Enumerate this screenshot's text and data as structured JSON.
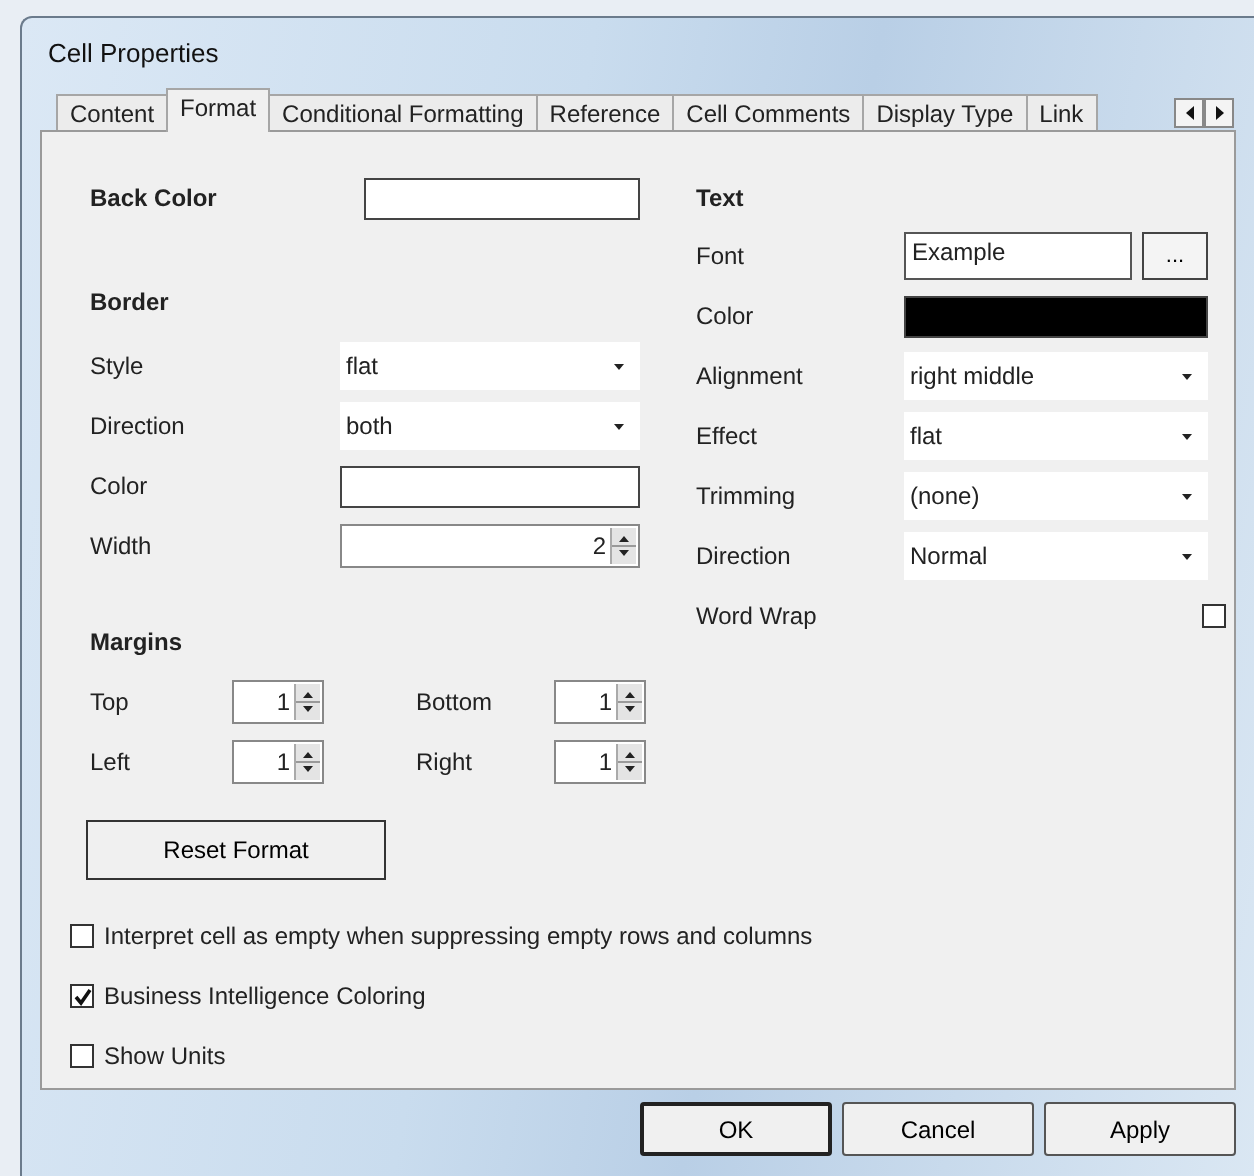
{
  "window": {
    "title": "Cell Properties"
  },
  "tabs": [
    {
      "label": "Content",
      "selected": false
    },
    {
      "label": "Format",
      "selected": true
    },
    {
      "label": "Conditional Formatting",
      "selected": false
    },
    {
      "label": "Reference",
      "selected": false
    },
    {
      "label": "Cell Comments",
      "selected": false
    },
    {
      "label": "Display Type",
      "selected": false
    },
    {
      "label": "Link",
      "selected": false
    }
  ],
  "back_color": {
    "label": "Back Color",
    "color": "#ffffff"
  },
  "border": {
    "heading": "Border",
    "fields": [
      {
        "kind": "dropdown",
        "label": "Style",
        "value": "flat"
      },
      {
        "kind": "dropdown",
        "label": "Direction",
        "value": "both"
      },
      {
        "kind": "swatch",
        "label": "Color",
        "color": "#ffffff"
      },
      {
        "kind": "spinner",
        "label": "Width",
        "value": "2"
      }
    ]
  },
  "margins": {
    "heading": "Margins",
    "fields": [
      {
        "label": "Top",
        "value": "1"
      },
      {
        "label": "Bottom",
        "value": "1"
      },
      {
        "label": "Left",
        "value": "1"
      },
      {
        "label": "Right",
        "value": "1"
      }
    ]
  },
  "reset_button": "Reset Format",
  "text": {
    "heading": "Text",
    "fields": [
      {
        "kind": "font",
        "label": "Font",
        "value": "Example",
        "button": "..."
      },
      {
        "kind": "swatch",
        "label": "Color",
        "color": "#000000"
      },
      {
        "kind": "dropdown",
        "label": "Alignment",
        "value": "right middle"
      },
      {
        "kind": "dropdown",
        "label": "Effect",
        "value": "flat"
      },
      {
        "kind": "dropdown",
        "label": "Trimming",
        "value": "(none)"
      },
      {
        "kind": "dropdown",
        "label": "Direction",
        "value": "Normal"
      },
      {
        "kind": "checkbox",
        "label": "Word Wrap",
        "checked": false
      }
    ]
  },
  "options": [
    {
      "label": "Interpret cell as empty when suppressing empty rows and columns",
      "checked": false
    },
    {
      "label": "Business Intelligence Coloring",
      "checked": true
    },
    {
      "label": "Show Units",
      "checked": false
    }
  ],
  "buttons": [
    {
      "label": "OK",
      "default": true
    },
    {
      "label": "Cancel",
      "default": false
    },
    {
      "label": "Apply",
      "default": false
    }
  ]
}
